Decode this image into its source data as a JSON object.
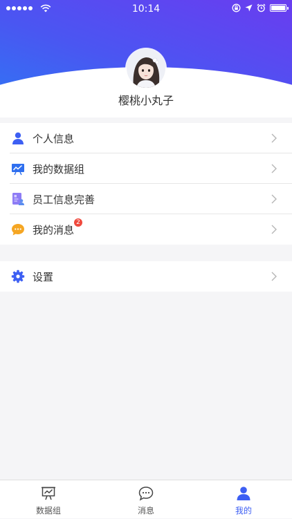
{
  "status_bar": {
    "time": "10:14"
  },
  "profile": {
    "username": "樱桃小丸子"
  },
  "menu": {
    "personal_info": "个人信息",
    "my_data_groups": "我的数据组",
    "employee_info": "员工信息完善",
    "my_messages": "我的消息",
    "messages_badge": "2",
    "settings": "设置"
  },
  "tabbar": {
    "data_groups": "数据组",
    "messages": "消息",
    "mine": "我的"
  },
  "colors": {
    "accent": "#3d5ff3",
    "badge": "#f04a3e",
    "header_gradient_start": "#2d78f4",
    "header_gradient_end": "#6a3cf0"
  }
}
